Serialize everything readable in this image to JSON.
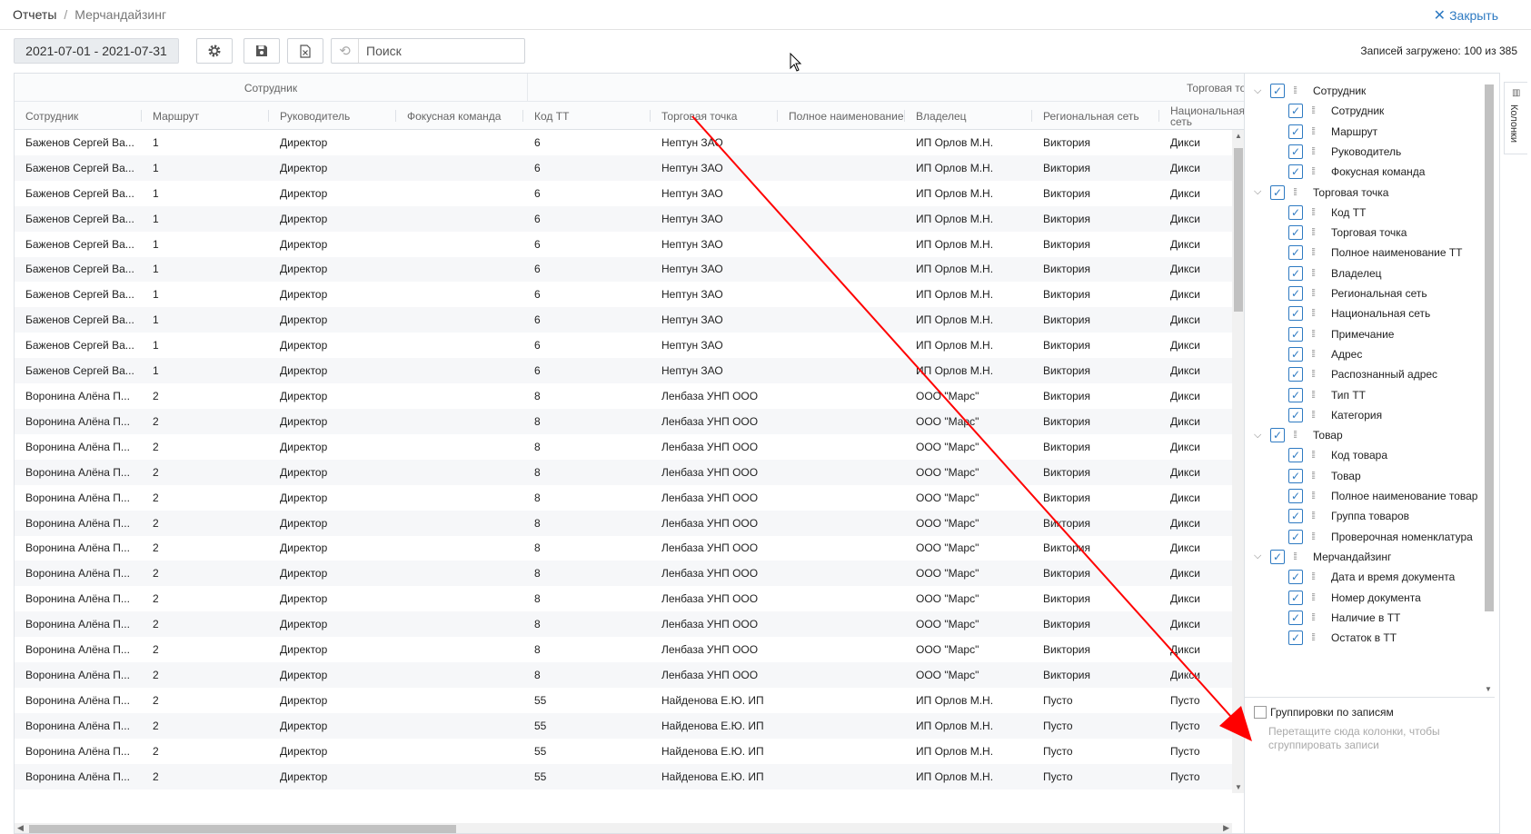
{
  "breadcrumb": {
    "parent": "Отчеты",
    "separator": "/",
    "current": "Мерчандайзинг"
  },
  "close_label": "Закрыть",
  "toolbar": {
    "date_range": "2021-07-01 - 2021-07-31",
    "search_placeholder": "Поиск",
    "records_info": "Записей загружено: 100 из 385",
    "icons": [
      "gear-icon",
      "save-icon",
      "excel-icon",
      "history-icon"
    ]
  },
  "grid": {
    "groups": [
      "Сотрудник",
      "Торговая то"
    ],
    "columns": [
      "Сотрудник",
      "Маршрут",
      "Руководитель",
      "Фокусная команда",
      "Код ТТ",
      "Торговая точка",
      "Полное наименование",
      "Владелец",
      "Региональная сеть",
      "Национальная сеть"
    ],
    "rows": [
      [
        "Баженов Сергей Ва...",
        "1",
        "Директор",
        "",
        "6",
        "Нептун ЗАО",
        "",
        "ИП Орлов М.Н.",
        "Виктория",
        "Дикси"
      ],
      [
        "Баженов Сергей Ва...",
        "1",
        "Директор",
        "",
        "6",
        "Нептун ЗАО",
        "",
        "ИП Орлов М.Н.",
        "Виктория",
        "Дикси"
      ],
      [
        "Баженов Сергей Ва...",
        "1",
        "Директор",
        "",
        "6",
        "Нептун ЗАО",
        "",
        "ИП Орлов М.Н.",
        "Виктория",
        "Дикси"
      ],
      [
        "Баженов Сергей Ва...",
        "1",
        "Директор",
        "",
        "6",
        "Нептун ЗАО",
        "",
        "ИП Орлов М.Н.",
        "Виктория",
        "Дикси"
      ],
      [
        "Баженов Сергей Ва...",
        "1",
        "Директор",
        "",
        "6",
        "Нептун ЗАО",
        "",
        "ИП Орлов М.Н.",
        "Виктория",
        "Дикси"
      ],
      [
        "Баженов Сергей Ва...",
        "1",
        "Директор",
        "",
        "6",
        "Нептун ЗАО",
        "",
        "ИП Орлов М.Н.",
        "Виктория",
        "Дикси"
      ],
      [
        "Баженов Сергей Ва...",
        "1",
        "Директор",
        "",
        "6",
        "Нептун ЗАО",
        "",
        "ИП Орлов М.Н.",
        "Виктория",
        "Дикси"
      ],
      [
        "Баженов Сергей Ва...",
        "1",
        "Директор",
        "",
        "6",
        "Нептун ЗАО",
        "",
        "ИП Орлов М.Н.",
        "Виктория",
        "Дикси"
      ],
      [
        "Баженов Сергей Ва...",
        "1",
        "Директор",
        "",
        "6",
        "Нептун ЗАО",
        "",
        "ИП Орлов М.Н.",
        "Виктория",
        "Дикси"
      ],
      [
        "Баженов Сергей Ва...",
        "1",
        "Директор",
        "",
        "6",
        "Нептун ЗАО",
        "",
        "ИП Орлов М.Н.",
        "Виктория",
        "Дикси"
      ],
      [
        "Воронина Алёна П...",
        "2",
        "Директор",
        "",
        "8",
        "Ленбаза УНП ООО",
        "",
        "ООО \"Марс\"",
        "Виктория",
        "Дикси"
      ],
      [
        "Воронина Алёна П...",
        "2",
        "Директор",
        "",
        "8",
        "Ленбаза УНП ООО",
        "",
        "ООО \"Марс\"",
        "Виктория",
        "Дикси"
      ],
      [
        "Воронина Алёна П...",
        "2",
        "Директор",
        "",
        "8",
        "Ленбаза УНП ООО",
        "",
        "ООО \"Марс\"",
        "Виктория",
        "Дикси"
      ],
      [
        "Воронина Алёна П...",
        "2",
        "Директор",
        "",
        "8",
        "Ленбаза УНП ООО",
        "",
        "ООО \"Марс\"",
        "Виктория",
        "Дикси"
      ],
      [
        "Воронина Алёна П...",
        "2",
        "Директор",
        "",
        "8",
        "Ленбаза УНП ООО",
        "",
        "ООО \"Марс\"",
        "Виктория",
        "Дикси"
      ],
      [
        "Воронина Алёна П...",
        "2",
        "Директор",
        "",
        "8",
        "Ленбаза УНП ООО",
        "",
        "ООО \"Марс\"",
        "Виктория",
        "Дикси"
      ],
      [
        "Воронина Алёна П...",
        "2",
        "Директор",
        "",
        "8",
        "Ленбаза УНП ООО",
        "",
        "ООО \"Марс\"",
        "Виктория",
        "Дикси"
      ],
      [
        "Воронина Алёна П...",
        "2",
        "Директор",
        "",
        "8",
        "Ленбаза УНП ООО",
        "",
        "ООО \"Марс\"",
        "Виктория",
        "Дикси"
      ],
      [
        "Воронина Алёна П...",
        "2",
        "Директор",
        "",
        "8",
        "Ленбаза УНП ООО",
        "",
        "ООО \"Марс\"",
        "Виктория",
        "Дикси"
      ],
      [
        "Воронина Алёна П...",
        "2",
        "Директор",
        "",
        "8",
        "Ленбаза УНП ООО",
        "",
        "ООО \"Марс\"",
        "Виктория",
        "Дикси"
      ],
      [
        "Воронина Алёна П...",
        "2",
        "Директор",
        "",
        "8",
        "Ленбаза УНП ООО",
        "",
        "ООО \"Марс\"",
        "Виктория",
        "Дикси"
      ],
      [
        "Воронина Алёна П...",
        "2",
        "Директор",
        "",
        "8",
        "Ленбаза УНП ООО",
        "",
        "ООО \"Марс\"",
        "Виктория",
        "Дикси"
      ],
      [
        "Воронина Алёна П...",
        "2",
        "Директор",
        "",
        "55",
        "Найденова  Е.Ю. ИП",
        "",
        "ИП Орлов М.Н.",
        "Пусто",
        "Пусто"
      ],
      [
        "Воронина Алёна П...",
        "2",
        "Директор",
        "",
        "55",
        "Найденова  Е.Ю. ИП",
        "",
        "ИП Орлов М.Н.",
        "Пусто",
        "Пусто"
      ],
      [
        "Воронина Алёна П...",
        "2",
        "Директор",
        "",
        "55",
        "Найденова  Е.Ю. ИП",
        "",
        "ИП Орлов М.Н.",
        "Пусто",
        "Пусто"
      ],
      [
        "Воронина Алёна П...",
        "2",
        "Директор",
        "",
        "55",
        "Найденова  Е.Ю. ИП",
        "",
        "ИП Орлов М.Н.",
        "Пусто",
        "Пусто"
      ]
    ]
  },
  "columns_panel": {
    "tab_label": "Колонки",
    "items": [
      {
        "label": "Сотрудник",
        "level": 0,
        "checked": true
      },
      {
        "label": "Сотрудник",
        "level": 1,
        "checked": true
      },
      {
        "label": "Маршрут",
        "level": 1,
        "checked": true
      },
      {
        "label": "Руководитель",
        "level": 1,
        "checked": true
      },
      {
        "label": "Фокусная команда",
        "level": 1,
        "checked": true
      },
      {
        "label": "Торговая точка",
        "level": 0,
        "checked": true
      },
      {
        "label": "Код ТТ",
        "level": 1,
        "checked": true
      },
      {
        "label": "Торговая точка",
        "level": 1,
        "checked": true
      },
      {
        "label": "Полное наименование ТТ",
        "level": 1,
        "checked": true
      },
      {
        "label": "Владелец",
        "level": 1,
        "checked": true
      },
      {
        "label": "Региональная сеть",
        "level": 1,
        "checked": true
      },
      {
        "label": "Национальная сеть",
        "level": 1,
        "checked": true
      },
      {
        "label": "Примечание",
        "level": 1,
        "checked": true
      },
      {
        "label": "Адрес",
        "level": 1,
        "checked": true
      },
      {
        "label": "Распознанный адрес",
        "level": 1,
        "checked": true
      },
      {
        "label": "Тип ТТ",
        "level": 1,
        "checked": true
      },
      {
        "label": "Категория",
        "level": 1,
        "checked": true
      },
      {
        "label": "Товар",
        "level": 0,
        "checked": true
      },
      {
        "label": "Код товара",
        "level": 1,
        "checked": true
      },
      {
        "label": "Товар",
        "level": 1,
        "checked": true
      },
      {
        "label": "Полное наименование товар",
        "level": 1,
        "checked": true
      },
      {
        "label": "Группа товаров",
        "level": 1,
        "checked": true
      },
      {
        "label": "Проверочная номенклатура",
        "level": 1,
        "checked": true
      },
      {
        "label": "Мерчандайзинг",
        "level": 0,
        "checked": true
      },
      {
        "label": "Дата и время документа",
        "level": 1,
        "checked": true
      },
      {
        "label": "Номер документа",
        "level": 1,
        "checked": true
      },
      {
        "label": "Наличие в ТТ",
        "level": 1,
        "checked": true
      },
      {
        "label": "Остаток в ТТ",
        "level": 1,
        "checked": true
      }
    ],
    "grouping_label": "Группировки по записям",
    "grouping_hint": "Перетащите сюда колонки, чтобы сгруппировать записи"
  },
  "colors": {
    "accent": "#2e7ac2",
    "annotation": "#ff0000"
  }
}
